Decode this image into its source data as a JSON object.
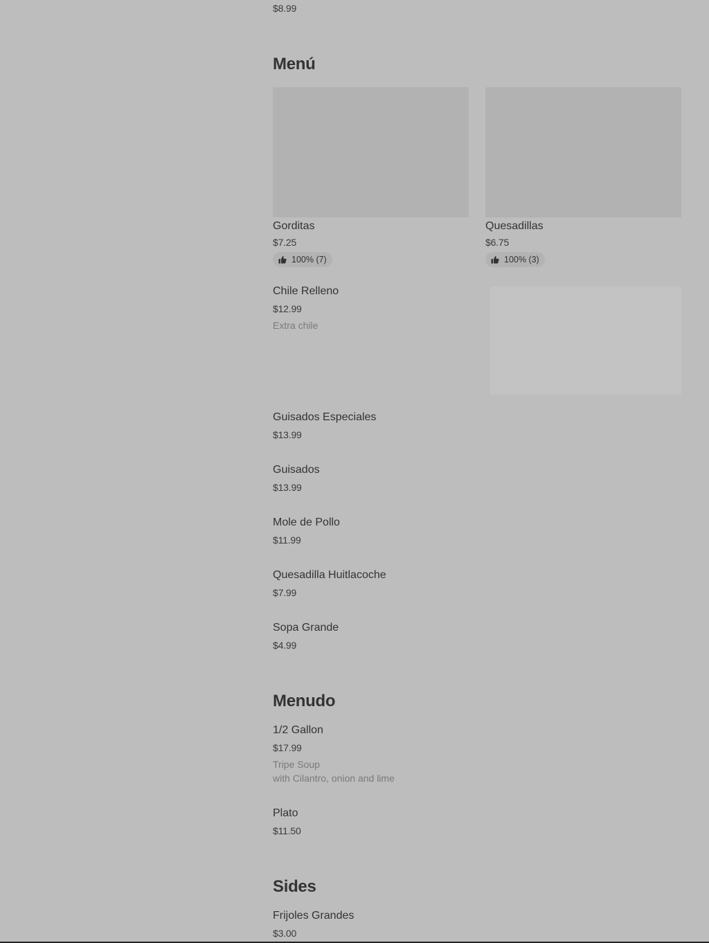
{
  "top_item": {
    "price": "$8.99"
  },
  "sections": {
    "menu": {
      "title": "Menú",
      "featured": [
        {
          "name": "Gorditas",
          "price": "$7.25",
          "rating": "100% (7)"
        },
        {
          "name": "Quesadillas",
          "price": "$6.75",
          "rating": "100% (3)"
        }
      ],
      "items": [
        {
          "name": "Chile Relleno",
          "price": "$12.99",
          "description": "Extra chile"
        },
        {
          "name": "Guisados Especiales",
          "price": "$13.99"
        },
        {
          "name": "Guisados",
          "price": "$13.99"
        },
        {
          "name": "Mole de Pollo",
          "price": "$11.99"
        },
        {
          "name": "Quesadilla Huitlacoche",
          "price": "$7.99"
        },
        {
          "name": "Sopa Grande",
          "price": "$4.99"
        }
      ]
    },
    "menudo": {
      "title": "Menudo",
      "items": [
        {
          "name": "1/2 Gallon",
          "price": "$17.99",
          "description_line1": "Tripe Soup",
          "description_line2": "with Cilantro, onion and lime"
        },
        {
          "name": "Plato",
          "price": "$11.50"
        }
      ]
    },
    "sides": {
      "title": "Sides",
      "items": [
        {
          "name": "Frijoles Grandes",
          "price": "$3.00"
        }
      ]
    }
  },
  "icons": {
    "rating": "thumbs-up-icon"
  }
}
